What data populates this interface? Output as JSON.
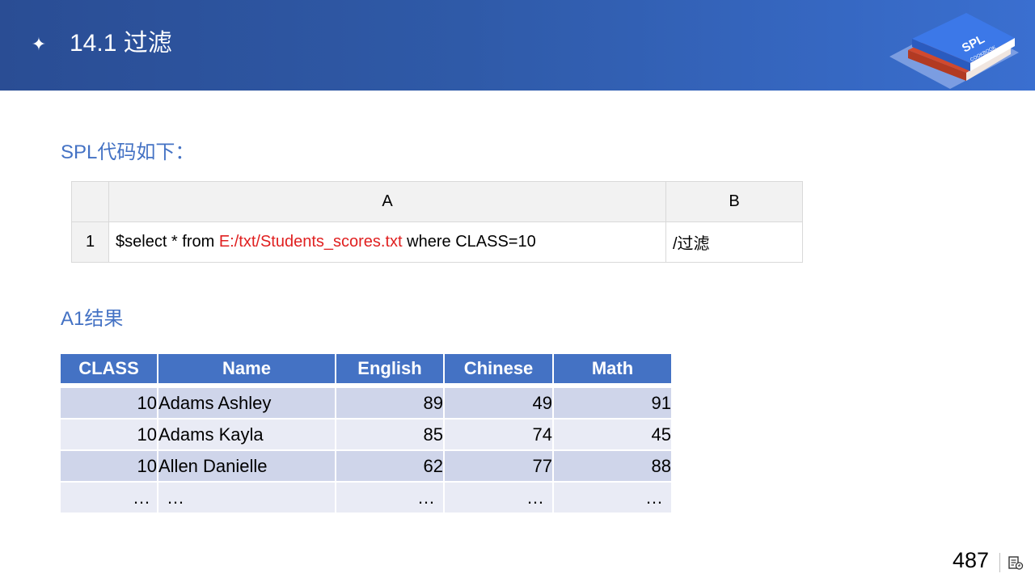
{
  "header": {
    "title": "14.1 过滤",
    "logo_text": "SPL",
    "logo_subtext": "COOKBOOK"
  },
  "code_section": {
    "label": "SPL代码如下："
  },
  "code_grid": {
    "columns": [
      "A",
      "B"
    ],
    "rows": [
      {
        "row_label": "1",
        "a_prefix": "$select * from ",
        "a_path": "E:/txt/Students_scores.txt",
        "a_suffix": " where CLASS=10",
        "b": "/过滤"
      }
    ]
  },
  "result_section": {
    "label": "A1结果"
  },
  "result_table": {
    "headers": [
      "CLASS",
      "Name",
      "English",
      "Chinese",
      "Math"
    ],
    "rows": [
      [
        "10",
        "Adams Ashley",
        "89",
        "49",
        "91"
      ],
      [
        "10",
        "Adams Kayla",
        "85",
        "74",
        "45"
      ],
      [
        "10",
        "Allen Danielle",
        "62",
        "77",
        "88"
      ],
      [
        "…",
        "…",
        "…",
        "…",
        "…"
      ]
    ]
  },
  "footer": {
    "page_number": "487"
  },
  "colors": {
    "header_bg": "#2f5aa8",
    "accent_blue": "#4472c4",
    "red_text": "#e02020",
    "row_dark": "#cfd5ea",
    "row_light": "#e9ebf5"
  }
}
